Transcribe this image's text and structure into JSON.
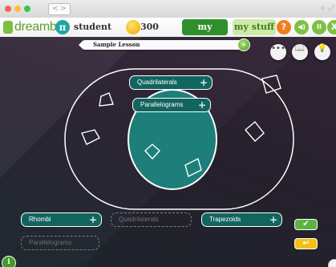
{
  "window": {
    "nav_arrows": "< >",
    "controls": "+ ⤢",
    "traffic_lights": [
      "#fc605c",
      "#fdbc40",
      "#34c84a"
    ]
  },
  "toolbar": {
    "logo_text": "dreambox",
    "user_badge": "π",
    "user_name": "student",
    "coins": "300",
    "tabs": [
      "my lessons",
      "my stuff"
    ],
    "help_icon": "?",
    "sound_icon": "◀)",
    "pause_icon": "II",
    "close_icon": "X",
    "colors": {
      "help": "#f07d20",
      "sound": "#7cc141",
      "pause": "#7cc141",
      "close": "#7cc141",
      "brand": "#7ac143"
    }
  },
  "lesson": {
    "title": "Sample Lesson",
    "progress_glyph": "»",
    "buttons": {
      "more": "•••",
      "book": "📖",
      "hint": "💡"
    }
  },
  "venn": {
    "outer_label": "Quadrilaterals",
    "inner_label": "Parallelograms",
    "inner_fill": "#1d7e7a"
  },
  "bank": {
    "items": [
      {
        "label": "Rhombi",
        "filled": true
      },
      {
        "label": "Quadrilaterals",
        "filled": false
      },
      {
        "label": "Trapezoids",
        "filled": true
      },
      {
        "label": "Parallelograms",
        "filled": false
      }
    ],
    "check_icon": "✔",
    "undo_icon": "↩",
    "info_icon": "i"
  }
}
